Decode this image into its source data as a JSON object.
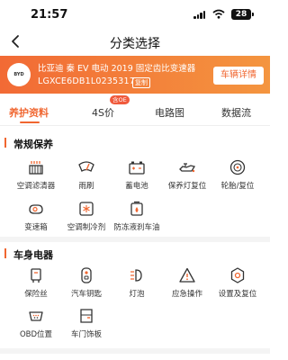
{
  "status": {
    "time": "21:57",
    "battery": "28"
  },
  "nav": {
    "title": "分类选择"
  },
  "vehicle": {
    "name": "比亚迪 秦 EV 电动 2019 固定齿比变速器",
    "vin": "LGXCE6DB1L0235317",
    "copy_label": "复制",
    "detail_button": "车辆详情",
    "logo_text": "BYD"
  },
  "tabs": [
    {
      "label": "养护资料"
    },
    {
      "label": "4S价"
    },
    {
      "label": "电路图"
    },
    {
      "label": "数据流"
    }
  ],
  "tab_badge": "含OE",
  "sections": [
    {
      "title": "常规保养",
      "items": [
        {
          "label": "空调滤清器",
          "icon": "ac-filter-icon"
        },
        {
          "label": "雨刷",
          "icon": "wiper-icon"
        },
        {
          "label": "蓄电池",
          "icon": "battery-icon"
        },
        {
          "label": "保养灯复位",
          "icon": "oil-lamp-icon"
        },
        {
          "label": "轮胎/复位",
          "icon": "tire-icon"
        },
        {
          "label": "变速箱",
          "icon": "gearbox-icon"
        },
        {
          "label": "空调制冷剂",
          "icon": "refrigerant-icon"
        },
        {
          "label": "防冻液刹车油",
          "icon": "coolant-icon"
        }
      ]
    },
    {
      "title": "车身电器",
      "items": [
        {
          "label": "保险丝",
          "icon": "fuse-icon"
        },
        {
          "label": "汽车钥匙",
          "icon": "car-key-icon"
        },
        {
          "label": "灯泡",
          "icon": "headlight-icon"
        },
        {
          "label": "应急操作",
          "icon": "warning-icon"
        },
        {
          "label": "设置及复位",
          "icon": "settings-icon"
        },
        {
          "label": "OBD位置",
          "icon": "obd-icon"
        },
        {
          "label": "车门饰板",
          "icon": "door-panel-icon"
        }
      ]
    }
  ],
  "colors": {
    "accent": "#f06630",
    "banner_start": "#f26a35",
    "banner_end": "#f4953f"
  }
}
